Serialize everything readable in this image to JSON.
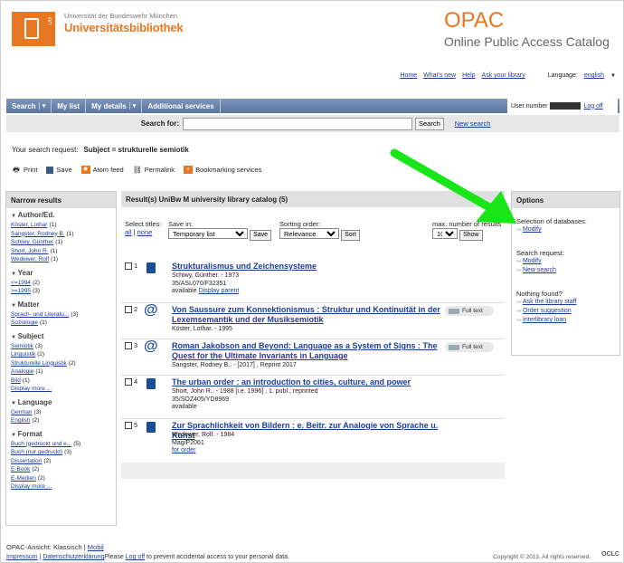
{
  "header": {
    "uni_line": "Universität der Bundeswehr München",
    "library": "Universitätsbibliothek",
    "logo_text": "UB",
    "opac": "OPAC",
    "opac_sub": "Online Public Access Catalog"
  },
  "toplinks": {
    "home": "Home",
    "whats_new": "What's new",
    "help": "Help",
    "ask": "Ask your library",
    "language_label": "Language:",
    "language_value": "english"
  },
  "nav": {
    "search": "Search",
    "mylist": "My list",
    "mydetails": "My details",
    "additional": "Additional services",
    "user_label": "User number",
    "logoff": "Log off"
  },
  "search": {
    "label": "Search for:",
    "value": "",
    "button": "Search",
    "new_search": "New search"
  },
  "request": {
    "label": "Your search request:",
    "value": "Subject = strukturelle semiotik"
  },
  "actions": {
    "print": "Print",
    "save": "Save",
    "atom": "Atom feed",
    "permalink": "Permalink",
    "bookmarking": "Bookmarking services"
  },
  "narrow": {
    "title": "Narrow results",
    "groups": [
      {
        "title": "Author/Ed.",
        "items": [
          [
            "Köster, Lothar",
            "(1)"
          ],
          [
            "Sangster, Rodney B.",
            "(1)"
          ],
          [
            "Schiwy, Günther",
            "(1)"
          ],
          [
            "Short, John R.",
            "(1)"
          ],
          [
            "Wedewer, Rolf",
            "(1)"
          ]
        ]
      },
      {
        "title": "Year",
        "items": [
          [
            "<=1994",
            "(2)"
          ],
          [
            ">=1995",
            "(3)"
          ]
        ]
      },
      {
        "title": "Matter",
        "items": [
          [
            "Sprach- und Literatu...",
            "(3)"
          ],
          [
            "Soziologie",
            "(1)"
          ]
        ]
      },
      {
        "title": "Subject",
        "items": [
          [
            "Semiotik",
            "(3)"
          ],
          [
            "Linguistik",
            "(2)"
          ],
          [
            "Strukturelle Linguistik",
            "(2)"
          ],
          [
            "Analogie",
            "(1)"
          ],
          [
            "Bild",
            "(1)"
          ],
          [
            "Display more ...",
            ""
          ]
        ]
      },
      {
        "title": "Language",
        "items": [
          [
            "German",
            "(3)"
          ],
          [
            "English",
            "(2)"
          ]
        ]
      },
      {
        "title": "Format",
        "items": [
          [
            "Buch (gedruckt und e...",
            "(5)"
          ],
          [
            "Buch (nur gedruckt)",
            "(3)"
          ],
          [
            "Dissertation",
            "(2)"
          ],
          [
            "E-Book",
            "(2)"
          ],
          [
            "E-Medien",
            "(2)"
          ],
          [
            "Display more ...",
            ""
          ]
        ]
      }
    ]
  },
  "results": {
    "title": "Result(s) UniBw M university library catalog (5)",
    "select_label": "Select titles:",
    "all": "all",
    "none": "none",
    "save_in_label": "Save in:",
    "save_in_value": "Temporary list",
    "save_btn": "Save",
    "sort_label": "Sorting order:",
    "sort_value": "Relevance",
    "sort_btn": "Sort",
    "max_label": "max. number of results",
    "max_value": "10",
    "show_btn": "Show",
    "fulltext": "Full text",
    "items": [
      {
        "num": "1",
        "title": "Strukturalismus und Zeichensysteme",
        "lines": [
          "Schiwy, Günther. - 1973",
          "35/ASL070/F32351"
        ],
        "avail": "available",
        "link": "Display parent"
      },
      {
        "num": "2",
        "title": "Von Saussure zum Konnektionismus : Struktur und Kontinuität in der Lexemsemantik und der Musiksemiotik",
        "lines": [
          "Köster, Lothar. - 1995"
        ]
      },
      {
        "num": "3",
        "title": "Roman Jakobson and Beyond: Language as a System of Signs : The Quest for the Ultimate Invariants in Language",
        "lines": [
          "Sangster, Rodney B.. - [2017] , Reprint 2017"
        ]
      },
      {
        "num": "4",
        "title": "The urban order : an introduction to cities, culture, and power",
        "lines": [
          "Short, John R.. - 1988 [i.e. 1996] , 1. publ., reprinted",
          "35/SOZ405/YD8969",
          "available"
        ]
      },
      {
        "num": "5",
        "title": "Zur Sprachlichkeit von Bildern : e. Beitr. zur Analogie von Sprache u. Kunst",
        "lines": [
          "Wedewer, Rolf. - 1984",
          "Mag/P2061"
        ],
        "link": "for order"
      }
    ]
  },
  "options": {
    "title": "Options",
    "db_label": "Selection of databases:",
    "db_modify": "Modify",
    "req_label": "Search request:",
    "req_modify": "Modify",
    "req_new": "New search",
    "nf_label": "Nothing found?",
    "nf_ask": "Ask the library staff",
    "nf_order": "Order suggestion",
    "nf_ill": "Interlibrary loan"
  },
  "footer": {
    "opac_view": "OPAC-Ansicht:",
    "classic": "Klassisch",
    "sep": "|",
    "mobile": "Mobil",
    "impressum": "Impressum",
    "privacy": "Datenschutzerklärung",
    "please": "Please",
    "logoff": "Log off",
    "logoff_text": "to prevent accidental access to your personal data.",
    "copyright": "Copyright © 2013. All rights reserved.",
    "oclc": "OCLC"
  },
  "colors": {
    "accent": "#e87722",
    "nav": "#5b76a0",
    "link": "#1a3c9e",
    "arrow": "#19e619"
  }
}
